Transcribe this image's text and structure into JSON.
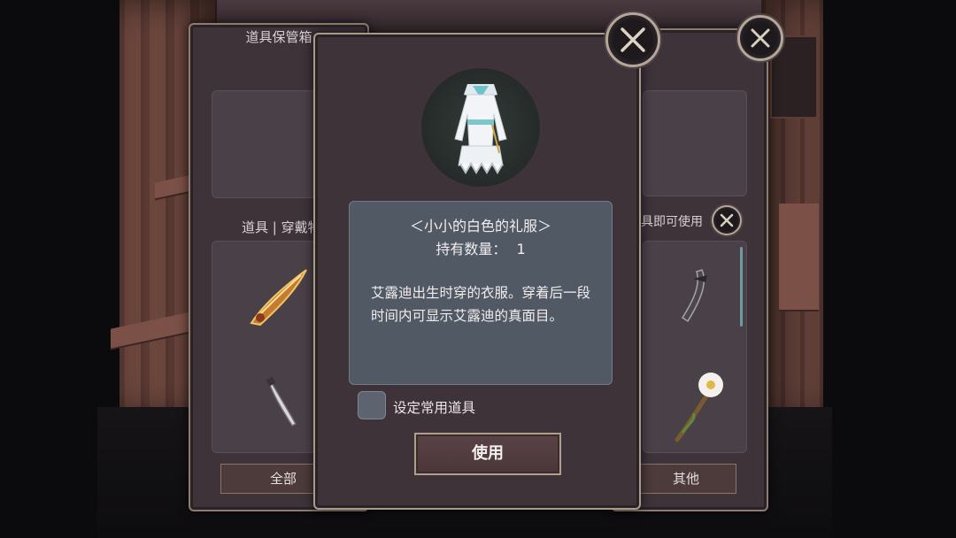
{
  "background_panel_left": {
    "title": "道具保管箱",
    "tabs_label": "道具 | 穿戴物品",
    "footer_button": "全部"
  },
  "background_panel_right": {
    "hint_label": "具即可使用",
    "footer_button": "其他"
  },
  "dialog": {
    "item_name": "＜小小的白色的礼服＞",
    "held_label": "持有数量：",
    "held_count": "1",
    "description": "艾露迪出生时穿的衣服。穿着后一段时间内可显示艾露迪的真面目。",
    "checkbox_label": "设定常用道具",
    "use_button": "使用"
  },
  "icons": {
    "close": "close-icon",
    "dress": "white-dress-icon",
    "sword": "golden-sword-icon",
    "dagger": "dagger-icon",
    "blade": "dark-blade-icon",
    "flower": "flower-staff-icon"
  }
}
